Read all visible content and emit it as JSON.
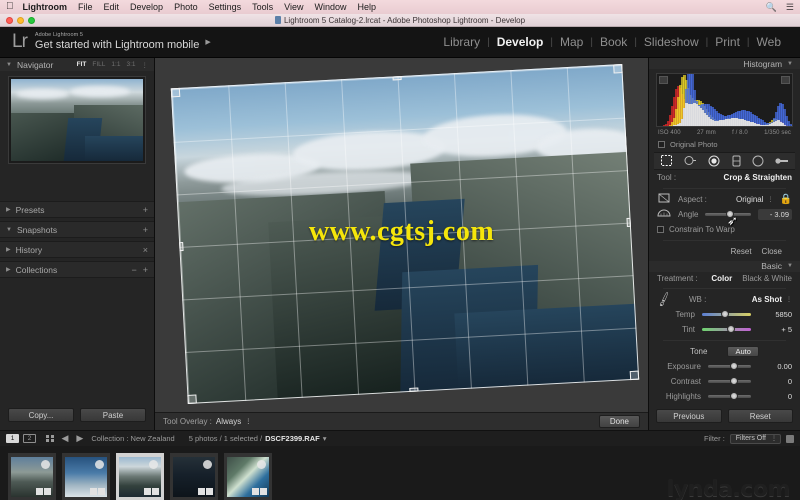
{
  "macmenu": {
    "apple_icon": "apple-icon",
    "app_name": "Lightroom",
    "items": [
      "File",
      "Edit",
      "Develop",
      "Photo",
      "Settings",
      "Tools",
      "View",
      "Window",
      "Help"
    ],
    "search_icon": "search-icon",
    "list_icon": "list-icon"
  },
  "window": {
    "title": "Lightroom 5 Catalog-2.lrcat - Adobe Photoshop Lightroom - Develop",
    "doc_icon": "document-icon"
  },
  "identity": {
    "logo": "Lr",
    "product": "Adobe Lightroom 5",
    "headline": "Get started with Lightroom mobile",
    "arrow": "▶"
  },
  "modules": {
    "items": [
      {
        "label": "Library",
        "active": false
      },
      {
        "label": "Develop",
        "active": true
      },
      {
        "label": "Map",
        "active": false
      },
      {
        "label": "Book",
        "active": false
      },
      {
        "label": "Slideshow",
        "active": false
      },
      {
        "label": "Print",
        "active": false
      },
      {
        "label": "Web",
        "active": false
      }
    ],
    "separator": "|"
  },
  "left_panel": {
    "navigator": {
      "title": "Navigator",
      "zoom_levels": [
        {
          "label": "FIT",
          "selected": true
        },
        {
          "label": "FILL",
          "selected": false
        },
        {
          "label": "1:1",
          "selected": false
        },
        {
          "label": "3:1",
          "selected": false
        }
      ]
    },
    "rows": [
      {
        "label": "Presets",
        "expanded": false,
        "right": "+",
        "right2": ""
      },
      {
        "label": "Snapshots",
        "expanded": true,
        "right": "+",
        "right2": ""
      },
      {
        "label": "History",
        "expanded": false,
        "right": "×",
        "right2": ""
      },
      {
        "label": "Collections",
        "expanded": false,
        "right": "−",
        "right2": "+"
      }
    ],
    "copy_button": "Copy...",
    "paste_button": "Paste"
  },
  "center": {
    "watermark": "www.cgtsj.com",
    "tool_overlay_label": "Tool Overlay :",
    "tool_overlay_value": "Always",
    "done_button": "Done",
    "crop_angle_deg": -3.09
  },
  "right_panel": {
    "histogram": {
      "title": "Histogram",
      "iso": "ISO 400",
      "focal": "27 mm",
      "aperture": "f / 8.0",
      "shutter": "1/350 sec",
      "original_photo": "Original Photo"
    },
    "tools": [
      "crop-tool-icon",
      "spot-removal-icon",
      "red-eye-icon",
      "graduated-filter-icon",
      "radial-filter-icon",
      "adjustment-brush-icon"
    ],
    "crop": {
      "tool_label": "Tool :",
      "tool_value": "Crop & Straighten",
      "aspect_label": "Aspect :",
      "aspect_value": "Original",
      "lock_icon": "lock-icon",
      "angle_label": "Angle",
      "angle_value": "- 3.09",
      "constrain_label": "Constrain To Warp",
      "reset_button": "Reset",
      "close_button": "Close"
    },
    "basic": {
      "title": "Basic",
      "treatment_label": "Treatment :",
      "treatment_color": "Color",
      "treatment_bw": "Black & White",
      "wb_label": "WB :",
      "wb_value": "As Shot",
      "eyedropper_icon": "eyedropper-icon",
      "sliders_wb": [
        {
          "label": "Temp",
          "value": "5850",
          "pos": 38
        },
        {
          "label": "Tint",
          "value": "+ 5",
          "pos": 52
        }
      ],
      "tone_label": "Tone",
      "auto_button": "Auto",
      "sliders_tone": [
        {
          "label": "Exposure",
          "value": "0.00",
          "pos": 50
        },
        {
          "label": "Contrast",
          "value": "0",
          "pos": 50
        },
        {
          "label": "Highlights",
          "value": "0",
          "pos": 50
        }
      ]
    },
    "previous_button": "Previous",
    "reset_button": "Reset"
  },
  "filmstrip_toolbar": {
    "tab1": "1",
    "tab2": "2",
    "grid_icon": "grid-view-icon",
    "back_arrow": "◀",
    "forward_arrow": "▶",
    "collection_label": "Collection : New Zealand",
    "photo_count": "5 photos / 1 selected /",
    "filename": "DSCF2399.RAF",
    "filename_arrow": "▾",
    "filter_label": "Filter :",
    "filter_value": "Filters Off"
  },
  "filmstrip": {
    "thumbs": [
      {
        "selected": false
      },
      {
        "selected": false
      },
      {
        "selected": true
      },
      {
        "selected": false
      },
      {
        "selected": false
      }
    ],
    "branding": "lynda.com"
  },
  "colors": {
    "accent": "#f5e60b",
    "panel_bg": "#252525",
    "stage_bg": "#3a3a3a",
    "menubar_bg": "#f0d9de"
  }
}
